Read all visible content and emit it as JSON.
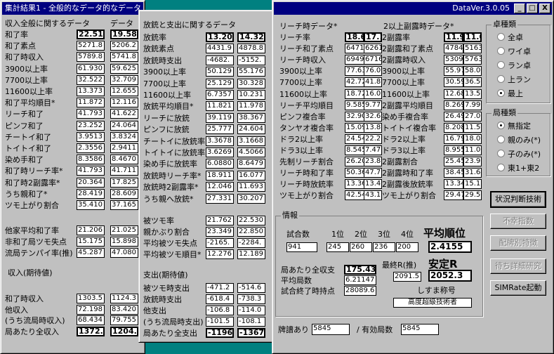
{
  "win1": {
    "title": "集計結果1 - 全般的なデータ的なデータ",
    "col_headers": [
      "データ",
      "データ"
    ],
    "sections": [
      {
        "title": "収入全般に関するデータ",
        "rows": [
          {
            "label": "和了率",
            "a": "22.51",
            "b": "19.58",
            "bold": true
          },
          {
            "label": "和了素点",
            "a": "5271.8",
            "b": "5206.2"
          },
          {
            "label": "和了時収入",
            "a": "5789.8",
            "b": "5741.8"
          },
          {
            "label": "3900以上率",
            "a": "61.930",
            "b": "59.625"
          },
          {
            "label": "7700以上率",
            "a": "32.522",
            "b": "32.709"
          },
          {
            "label": "11600以上率",
            "a": "13.373",
            "b": "12.655"
          },
          {
            "label": "和了平均順目*",
            "a": "11.872",
            "b": "12.116"
          },
          {
            "label": "リーチ和了",
            "a": "41.793",
            "b": "41.622"
          },
          {
            "label": "ピンフ和了",
            "a": "23.252",
            "b": "24.064"
          },
          {
            "label": "チートイ和了",
            "a": "3.9513",
            "b": "3.8324"
          },
          {
            "label": "トイトイ和了",
            "a": "2.3556",
            "b": "2.9411"
          },
          {
            "label": "染め手和了",
            "a": "8.3586",
            "b": "8.4670"
          },
          {
            "label": "和了時リーチ率*",
            "a": "41.793",
            "b": "41.711"
          },
          {
            "label": "和了時2副露率*",
            "a": "20.364",
            "b": "17.825"
          },
          {
            "label": "うち親和了*",
            "a": "28.419",
            "b": "28.609"
          },
          {
            "label": "ツモ上がり割合",
            "a": "35.410",
            "b": "37.165"
          }
        ]
      },
      {
        "title": "",
        "rows": [
          {
            "label": "他家平均和了率",
            "a": "21.206",
            "b": "21.025"
          },
          {
            "label": "非和了局ツモ失点",
            "a": "15.175",
            "b": "15.898"
          },
          {
            "label": "流局テンパイ率(推)",
            "a": "45.287",
            "b": "47.080"
          }
        ]
      },
      {
        "title": "収入(期待値)",
        "rows": [
          {
            "label": "和了時収入",
            "a": "1303.5",
            "b": "1124.3"
          },
          {
            "label": "他収入",
            "a": "72.198",
            "b": "83.420"
          },
          {
            "label": "(うち流局時収入)",
            "a": "68.434",
            "b": "79.755"
          },
          {
            "label": "局あたり全収入",
            "a": "1372.0",
            "b": "1204.0",
            "bold": true
          }
        ]
      }
    ]
  },
  "win2": {
    "sections": [
      {
        "title": "放銃と支出に関するデータ",
        "col_headers": [
          "データ",
          "データ"
        ],
        "rows": [
          {
            "label": "放銃率",
            "a": "13.20",
            "b": "14.32",
            "bold": true
          },
          {
            "label": "放銃素点",
            "a": "4431.9",
            "b": "4878.8"
          },
          {
            "label": "放銃時支出",
            "a": "-4682.",
            "b": "-5152."
          },
          {
            "label": "3900以上率",
            "a": "50.129",
            "b": "55.176"
          },
          {
            "label": "7700以上率",
            "a": "25.129",
            "b": "30.328"
          },
          {
            "label": "11600以上率",
            "a": "6.7357",
            "b": "10.231"
          },
          {
            "label": "放銃平均順目*",
            "a": "11.821",
            "b": "11.978"
          },
          {
            "label": "リーチに放銃",
            "a": "39.119",
            "b": "38.367"
          },
          {
            "label": "ピンフに放銃",
            "a": "25.777",
            "b": "24.604"
          },
          {
            "label": "チートイに放銃率",
            "a": "3.3678",
            "b": "3.1668"
          },
          {
            "label": "トイトイに放銃率",
            "a": "3.6269",
            "b": "4.5066"
          },
          {
            "label": "染め手に放銃率",
            "a": "6.0880",
            "b": "8.6479"
          },
          {
            "label": "放銃時リーチ率*",
            "a": "18.911",
            "b": "16.077"
          },
          {
            "label": "放銃時2副露率*",
            "a": "12.046",
            "b": "11.693"
          },
          {
            "label": "うち親へ放銃*",
            "a": "27.331",
            "b": "30.207"
          }
        ]
      },
      {
        "title": "",
        "rows": [
          {
            "label": "被ツモ率",
            "a": "21.762",
            "b": "22.530"
          },
          {
            "label": "親かぶり割合",
            "a": "23.349",
            "b": "22.850"
          },
          {
            "label": "平均被ツモ失点",
            "a": "-2165.",
            "b": "-2284."
          },
          {
            "label": "平均被ツモ順目*",
            "a": "12.276",
            "b": "12.189"
          }
        ]
      },
      {
        "title": "支出(期待値)",
        "rows": [
          {
            "label": "被ツモ時支出",
            "a": "-471.2",
            "b": "-514.6"
          },
          {
            "label": "放銃時支出",
            "a": "-618.4",
            "b": "-738.3"
          },
          {
            "label": "他支出",
            "a": "-106.8",
            "b": "-114.0"
          },
          {
            "label": "(うち流局時支出)",
            "a": "-101.5",
            "b": "-108.1"
          },
          {
            "label": "局あたり全支出",
            "a": "-1196.",
            "b": "-1367.",
            "bold": true
          }
        ]
      }
    ]
  },
  "win3": {
    "title": "DataVer.3.0.05",
    "controls": [
      "_",
      "□",
      "X"
    ],
    "reach": {
      "title": "リーチ時データ*",
      "rows": [
        {
          "label": "リーチ率",
          "a": "18.66",
          "b": "17.1",
          "bold": true
        },
        {
          "label": "リーチ和了素点",
          "a": "6471.",
          "b": "6261"
        },
        {
          "label": "リーチ時収入",
          "a": "6949",
          "b": "6716"
        },
        {
          "label": "3900以上率",
          "a": "77.63",
          "b": "76.06"
        },
        {
          "label": "7700以上率",
          "a": "42.72",
          "b": "41.88"
        },
        {
          "label": "11600以上率",
          "a": "18.72",
          "b": "16.02"
        },
        {
          "label": "リーチ平均順目",
          "a": "9.585",
          "b": "9.771"
        },
        {
          "label": "ピンフ複合率",
          "a": "32.90",
          "b": "32.69"
        },
        {
          "label": "タンヤオ複合率",
          "a": "15.09",
          "b": "13.89"
        },
        {
          "label": "ドラ2以上率",
          "a": "24.54",
          "b": "22.22"
        },
        {
          "label": "ドラ3以上率",
          "a": "8.545",
          "b": "7.478"
        },
        {
          "label": "先制リーチ割合",
          "a": "26.20",
          "b": "23.82"
        },
        {
          "label": "リーチ時和了率",
          "a": "50.36",
          "b": "47.75"
        },
        {
          "label": "リーチ時放銃率",
          "a": "13.36",
          "b": "13.46"
        },
        {
          "label": "ツモ上がり割合",
          "a": "42.54",
          "b": "43.16"
        }
      ]
    },
    "furo": {
      "title": "2以上副露時データ*",
      "rows": [
        {
          "label": "2副露率",
          "a": "11.9",
          "b": "11.0",
          "bold": true
        },
        {
          "label": "2副露和了素点",
          "a": "4784",
          "b": "5163"
        },
        {
          "label": "2副露時収入",
          "a": "5309",
          "b": "5763"
        },
        {
          "label": "3900以上率",
          "a": "55.97",
          "b": "58.00"
        },
        {
          "label": "7700以上率",
          "a": "30.59",
          "b": "36.50"
        },
        {
          "label": "11600以上率",
          "a": "12.68",
          "b": "13.50"
        },
        {
          "label": "2副露平均順目",
          "a": "8.269",
          "b": "7.999"
        },
        {
          "label": "染め手複合率",
          "a": "26.49",
          "b": "27.00"
        },
        {
          "label": "トイトイ複合率",
          "a": "8.208",
          "b": "11.50"
        },
        {
          "label": "ドラ2以上率",
          "a": "16.79",
          "b": "18.00"
        },
        {
          "label": "ドラ3以上率",
          "a": "8.955",
          "b": "11.00"
        },
        {
          "label": "2副露割合",
          "a": "25.45",
          "b": "23.91"
        },
        {
          "label": "2副露時和了率",
          "a": "38.45",
          "b": "31.64"
        },
        {
          "label": "2副露後放銃率",
          "a": "13.34",
          "b": "15.15"
        },
        {
          "label": "ツモ上がり割合",
          "a": "29.47",
          "b": "29.50"
        }
      ]
    },
    "table_type": {
      "title": "卓種類",
      "options": [
        "全卓",
        "ワイ卓",
        "ラン卓",
        "上ラン",
        "最上"
      ],
      "selected": 4
    },
    "game_type": {
      "title": "局種類",
      "options": [
        "無指定",
        "親のみ(*)",
        "子のみ(*)",
        "東1+東2"
      ],
      "selected": 0
    },
    "buttons": [
      "状況判断技術",
      "不幸指数",
      "配牌別特徴",
      "待ち詳細研究",
      "SIMRate起動"
    ],
    "info": {
      "title": "情報",
      "games_label": "試合数",
      "games": "941",
      "rank_headers": [
        "1位",
        "2位",
        "3位",
        "4位"
      ],
      "ranks": [
        "245",
        "260",
        "236",
        "200"
      ],
      "avg_rank_label": "平均順位",
      "avg_rank": "2.4155",
      "income_label": "局あたり全収支",
      "income": "175.43",
      "avg_hands_label": "平均局数",
      "avg_hands": "6.21147",
      "end_points_label": "試合終了時持点",
      "end_points": "28089.6",
      "last_r_label": "最終R(推)",
      "last_r": "2091.5",
      "stable_r_label": "安定R",
      "stable_r": "2052.3",
      "title_label": "しすま称号",
      "title_value": "高度超級技術者"
    },
    "footer": {
      "paifu_label": "牌譜あり",
      "paifu": "5845",
      "valid_label": "/ 有効局数",
      "valid": "5845"
    }
  }
}
